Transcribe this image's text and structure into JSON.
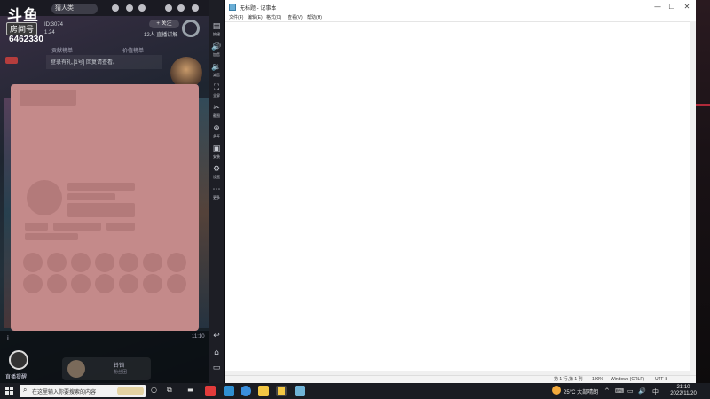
{
  "emulator": {
    "logo_text": "斗鱼",
    "badge_text": "房间号",
    "room_number": "6462330",
    "tab_chip": "猜人类",
    "room_id_line": "ID:3074",
    "room_sub_line": "1.24",
    "follow_label": "+ 关注",
    "fans_line": "12人 直播讲解",
    "tabs": [
      "贡献榜单",
      "价值榜单"
    ],
    "notice": "登录有礼,[1号] 回复请查看。",
    "bottom_left_label": "直播提醒",
    "bottom_center_title": "铃铛",
    "bottom_center_sub": "粉丝团",
    "bottom_right_label": "11:10",
    "bottom_info": "i"
  },
  "sidebar": {
    "items": [
      {
        "icon": "▤",
        "label": "按键"
      },
      {
        "icon": "🔊",
        "label": "加音"
      },
      {
        "icon": "🔉",
        "label": "减音"
      },
      {
        "icon": "⛶",
        "label": "全屏"
      },
      {
        "icon": "✂",
        "label": "截图"
      },
      {
        "icon": "⊕",
        "label": "多开"
      },
      {
        "icon": "▣",
        "label": "安装"
      },
      {
        "icon": "⚙",
        "label": "设置"
      },
      {
        "icon": "⋯",
        "label": "更多"
      }
    ],
    "bottom": [
      {
        "icon": "↩",
        "name": "back-icon"
      },
      {
        "icon": "⌂",
        "name": "home-icon"
      },
      {
        "icon": "▭",
        "name": "recent-apps-icon"
      }
    ]
  },
  "notepad": {
    "title": "无标题 - 记事本",
    "menu": [
      "文件(F)",
      "编辑(E)",
      "格式(O)",
      "查看(V)",
      "帮助(H)"
    ],
    "minimize": "—",
    "maximize": "☐",
    "close": "✕",
    "status": {
      "position": "第 1 行,第 1 列",
      "zoom": "100%",
      "line_ending": "Windows (CRLF)",
      "encoding": "UTF-8"
    }
  },
  "taskbar": {
    "search_placeholder": "在这里输入你要搜索的内容",
    "weather": "25°C 大部晴朗",
    "time": "21:10",
    "date": "2022/11/20",
    "tray_icons": [
      "^",
      "⌨",
      "▭",
      "🔊",
      "中"
    ],
    "app_colors": [
      "#e23b3b",
      "#2f8fd1",
      "#3a8edc",
      "#f2c744",
      "#f2c744",
      "#6fb3d6"
    ]
  },
  "colors": {
    "placeholder_card": "#c48a8a",
    "skeleton": "#b37a7a",
    "notepad_bg": "#ffffff",
    "taskbar_bg": "#1a1c22"
  }
}
